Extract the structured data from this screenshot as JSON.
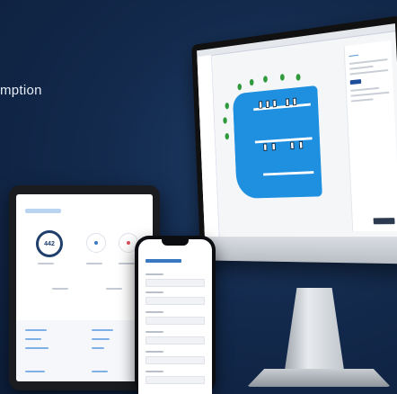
{
  "headline": {
    "text": "mption"
  },
  "tablet": {
    "gauge_value": "442"
  },
  "icons": {
    "tablet_status_1": "info-icon",
    "tablet_status_2": "alert-icon",
    "tablet_status_3": "boat-icon"
  },
  "colors": {
    "background": "#132a4d",
    "water": "#1f8fe0",
    "accent": "#1f3e6b",
    "link": "#7eb2e6"
  }
}
